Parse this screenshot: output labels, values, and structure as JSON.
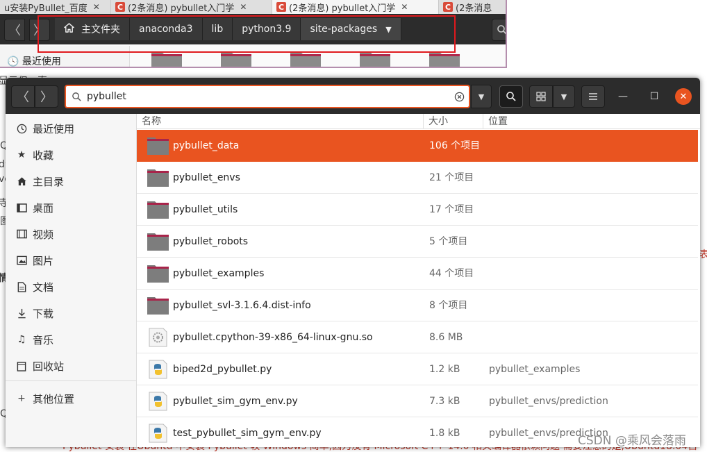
{
  "background_page": {
    "left_fragments": [
      "显示但一直",
      "Q",
      "d分",
      "ve",
      "寺",
      "图",
      "情",
      "Q"
    ],
    "right_fragments": [
      "表"
    ],
    "bottom_line_red": "Pybullet 安装 在Ubuntu 中安装 Pybullet 较 Windows 简单,因为没有 Microsoft C++ 14.0 相关编译器依赖问题 需要注意的是,Ubuntu18.04自"
  },
  "browser_tabs": [
    {
      "label": "u安装PyBullet_百度",
      "active": false
    },
    {
      "label": "(2条消息) pybullet入门学",
      "active": false
    },
    {
      "label": "(2条消息) pybullet入门学",
      "active": true
    },
    {
      "label": "(2条消息",
      "active": false
    }
  ],
  "bg_window": {
    "breadcrumbs": [
      "主文件夹",
      "anaconda3",
      "lib",
      "python3.9",
      "site-packages"
    ],
    "sidebar_peek": "最近使用"
  },
  "fg_window": {
    "search_value": "pybullet",
    "sidebar": [
      {
        "label": "最近使用",
        "icon": "clock-icon"
      },
      {
        "label": "收藏",
        "icon": "star-icon"
      },
      {
        "label": "主目录",
        "icon": "home-icon"
      },
      {
        "label": "桌面",
        "icon": "desktop-icon"
      },
      {
        "label": "视频",
        "icon": "film-icon"
      },
      {
        "label": "图片",
        "icon": "image-icon"
      },
      {
        "label": "文档",
        "icon": "document-icon"
      },
      {
        "label": "下载",
        "icon": "download-icon"
      },
      {
        "label": "音乐",
        "icon": "music-icon"
      },
      {
        "label": "回收站",
        "icon": "trash-icon"
      },
      {
        "label": "其他位置",
        "icon": "plus-icon"
      }
    ],
    "columns": {
      "name": "名称",
      "size": "大小",
      "location": "位置"
    },
    "files": [
      {
        "name": "pybullet_data",
        "size": "106 个项目",
        "location": "",
        "type": "folder",
        "selected": true
      },
      {
        "name": "pybullet_envs",
        "size": "21 个项目",
        "location": "",
        "type": "folder",
        "selected": false
      },
      {
        "name": "pybullet_utils",
        "size": "17 个项目",
        "location": "",
        "type": "folder",
        "selected": false
      },
      {
        "name": "pybullet_robots",
        "size": "5 个项目",
        "location": "",
        "type": "folder",
        "selected": false
      },
      {
        "name": "pybullet_examples",
        "size": "44 个项目",
        "location": "",
        "type": "folder",
        "selected": false
      },
      {
        "name": "pybullet_svl-3.1.6.4.dist-info",
        "size": "8 个项目",
        "location": "",
        "type": "folder",
        "selected": false
      },
      {
        "name": "pybullet.cpython-39-x86_64-linux-gnu.so",
        "size": "8.6 MB",
        "location": "",
        "type": "library",
        "selected": false
      },
      {
        "name": "biped2d_pybullet.py",
        "size": "1.2 kB",
        "location": "pybullet_examples",
        "type": "python",
        "selected": false
      },
      {
        "name": "pybullet_sim_gym_env.py",
        "size": "7.3 kB",
        "location": "pybullet_envs/prediction",
        "type": "python",
        "selected": false
      },
      {
        "name": "test_pybullet_sim_gym_env.py",
        "size": "1.8 kB",
        "location": "pybullet_envs/prediction",
        "type": "python",
        "selected": false
      }
    ]
  },
  "watermark": "CSDN @乘风会落雨",
  "colors": {
    "accent": "#e95420",
    "header": "#2c2c2c",
    "annotation_box": "#e0191d"
  }
}
